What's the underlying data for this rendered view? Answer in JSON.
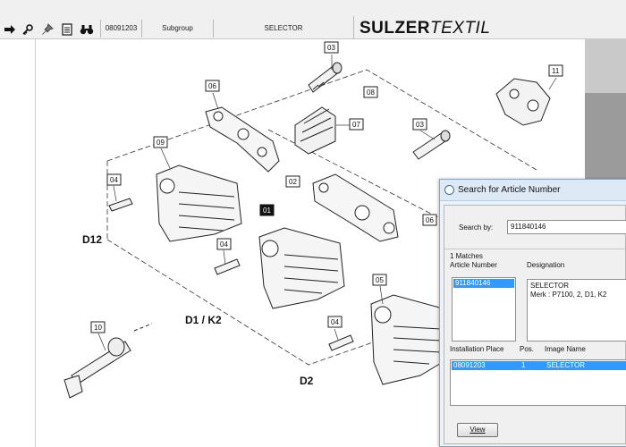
{
  "toolbar": {
    "icons": [
      "arrow-right-icon",
      "key-icon",
      "pushpin-icon",
      "document-icon",
      "binoculars-icon"
    ],
    "article_code": "08091203",
    "subgroup_label": "Subgroup",
    "selector_label": "SELECTOR",
    "brand_bold": "SULZER",
    "brand_thin": "TEXTIL"
  },
  "drawing": {
    "part_labels": [
      "03",
      "11",
      "06",
      "08",
      "07",
      "03",
      "09",
      "02",
      "04",
      "01",
      "06",
      "04",
      "05",
      "04",
      "10"
    ],
    "region_labels": [
      "D12",
      "D1 / K2",
      "D2"
    ]
  },
  "dialog": {
    "title": "Search for Article Number",
    "search_by_label": "Search by:",
    "search_value": "911840146",
    "matches_label": "1 Matches",
    "article_number_header": "Article Number",
    "designation_header": "Designation",
    "article_number_value": "911840146",
    "designation_line1": "SELECTOR",
    "designation_line2": "Merk : P7100, 2, D1, K2",
    "installation_place_header": "Installation Place",
    "pos_header": "Pos.",
    "image_name_header": "Image Name",
    "row": {
      "installation_place": "08091203",
      "pos": "1",
      "image_name": "SELECTOR"
    },
    "view_button": "View"
  }
}
